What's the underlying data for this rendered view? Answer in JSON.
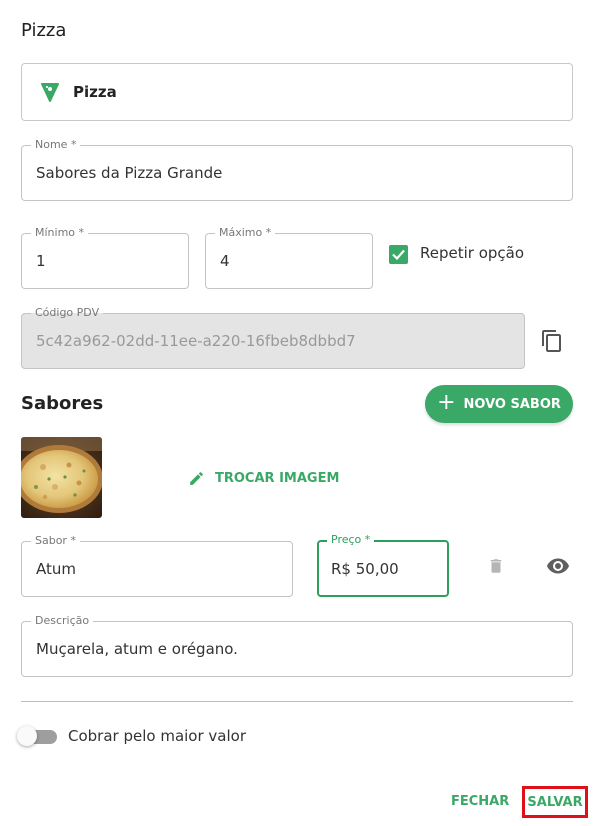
{
  "header": {
    "title": "Pizza"
  },
  "type_selector": {
    "label": "Pizza",
    "icon": "pizza-slice-icon"
  },
  "nome": {
    "label": "Nome *",
    "value": "Sabores da Pizza Grande"
  },
  "minimo": {
    "label": "Mínimo *",
    "value": "1"
  },
  "maximo": {
    "label": "Máximo *",
    "value": "4"
  },
  "repetir": {
    "label": "Repetir opção",
    "checked": true
  },
  "codigo_pdv": {
    "label": "Código PDV",
    "value": "5c42a962-02dd-11ee-a220-16fbeb8dbbd7",
    "copy_icon": "copy-icon"
  },
  "sabores": {
    "title": "Sabores",
    "add_button": "NOVO SABOR",
    "change_image_button": "TROCAR IMAGEM",
    "item": {
      "sabor": {
        "label": "Sabor *",
        "value": "Atum"
      },
      "preco": {
        "label": "Preço *",
        "value": "R$ 50,00"
      },
      "descricao": {
        "label": "Descrição",
        "value": "Muçarela, atum e orégano."
      }
    }
  },
  "cobrar": {
    "label": "Cobrar pelo maior valor",
    "enabled": false
  },
  "footer": {
    "close_label": "FECHAR",
    "save_label": "SALVAR"
  },
  "colors": {
    "accent": "#3aa866",
    "highlight": "#e0101a",
    "disabled_bg": "#e4e4e4"
  }
}
